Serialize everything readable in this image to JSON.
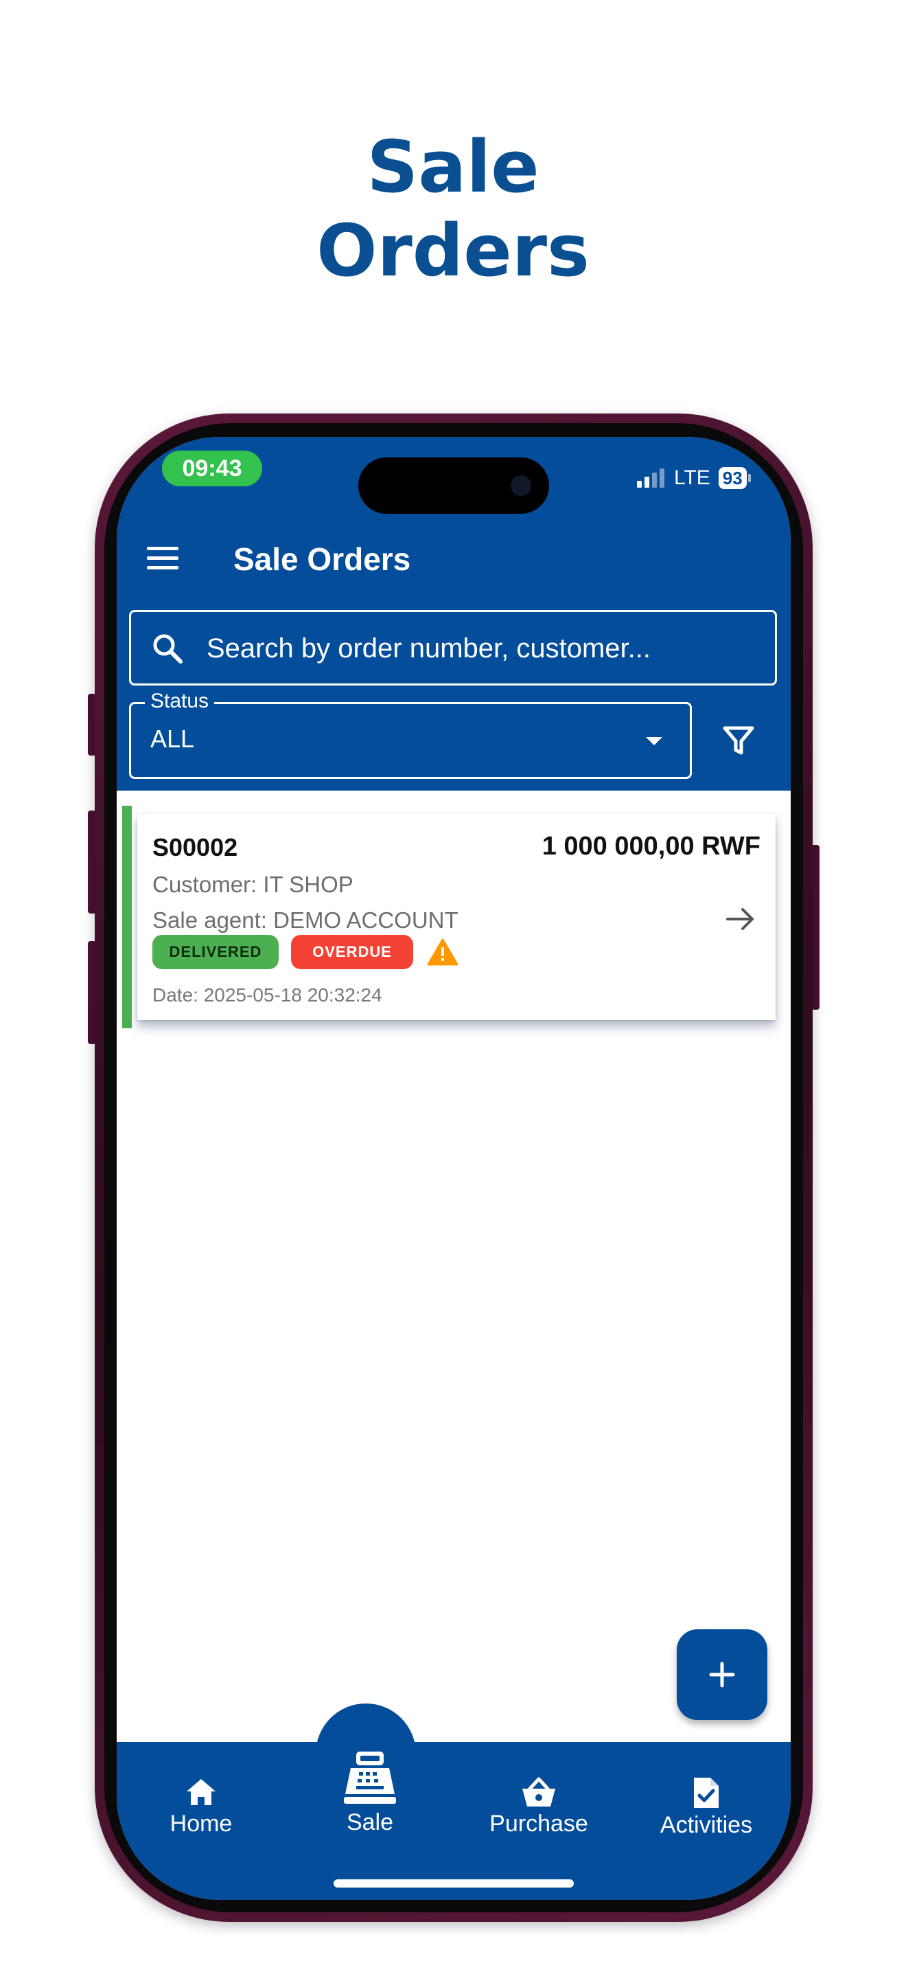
{
  "promo": {
    "title_line1": "Sale",
    "title_line2": "Orders"
  },
  "status_bar": {
    "time": "09:43",
    "network": "LTE",
    "battery": "93"
  },
  "app_bar": {
    "title": "Sale Orders"
  },
  "search": {
    "placeholder": "Search by order number, customer..."
  },
  "status_filter": {
    "label": "Status",
    "value": "ALL"
  },
  "orders": [
    {
      "number": "S00002",
      "amount": "1 000 000,00 RWF",
      "customer": "Customer: IT SHOP",
      "agent": "Sale agent: DEMO ACCOUNT",
      "badges": [
        "DELIVERED",
        "OVERDUE"
      ],
      "date": "Date: 2025-05-18 20:32:24"
    }
  ],
  "fab": {
    "icon": "plus-icon"
  },
  "bottom_nav": [
    {
      "label": "Home",
      "icon": "home-icon"
    },
    {
      "label": "Sale",
      "icon": "cash-register-icon",
      "active": true
    },
    {
      "label": "Purchase",
      "icon": "basket-icon"
    },
    {
      "label": "Activities",
      "icon": "document-check-icon"
    }
  ],
  "colors": {
    "primary": "#044d9a",
    "delivered": "#4caf50",
    "overdue": "#f44336",
    "warning": "#ff9800",
    "time_pill": "#33c24d"
  }
}
